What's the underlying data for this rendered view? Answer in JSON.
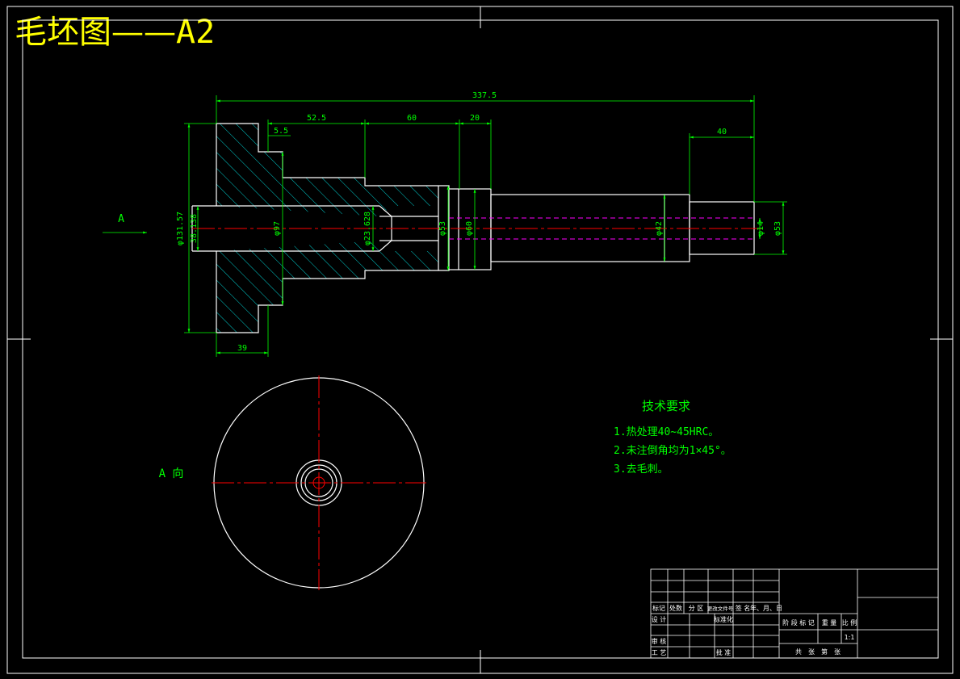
{
  "title": {
    "main": "毛坯图",
    "dash": "——",
    "code": "A2"
  },
  "dimensions": {
    "total_length": "337.5",
    "seg_1": "52.5",
    "seg_2": "60",
    "seg_3": "20",
    "step": "5.5",
    "right_end": "40",
    "flange_width": "39",
    "outer_dia": "φ131.57",
    "bore_dia": "38.138",
    "d97": "φ97",
    "d23": "φ23.628",
    "d53a": "φ53",
    "d60": "φ60",
    "d42": "φ42",
    "d14": "φ14",
    "d53b": "φ53"
  },
  "view_labels": {
    "arrow": "A",
    "view": "A 向"
  },
  "requirements": {
    "heading": "技术要求",
    "items": [
      "1.热处理40~45HRC。",
      "2.未注倒角均为1×45°。",
      "3.去毛刺。"
    ]
  },
  "title_block": {
    "row_labels": [
      "标记",
      "处数",
      "分 区",
      "更改文件号",
      "签 名",
      "年、月、日"
    ],
    "design": "设 计",
    "standard": "标准化",
    "review": "审 核",
    "process": "工 艺",
    "approve": "批 准",
    "stage_mark": "阶 段 标 记",
    "weight": "重 量",
    "scale": "比 例",
    "scale_value": "1:1",
    "sheets": "共　张　第　张"
  },
  "colors": {
    "outline": "#ffffff",
    "dimension": "#00ff00",
    "center": "#ff0000",
    "hatch": "#00ffff",
    "hidden": "#ff00ff",
    "title": "#ffff00"
  }
}
